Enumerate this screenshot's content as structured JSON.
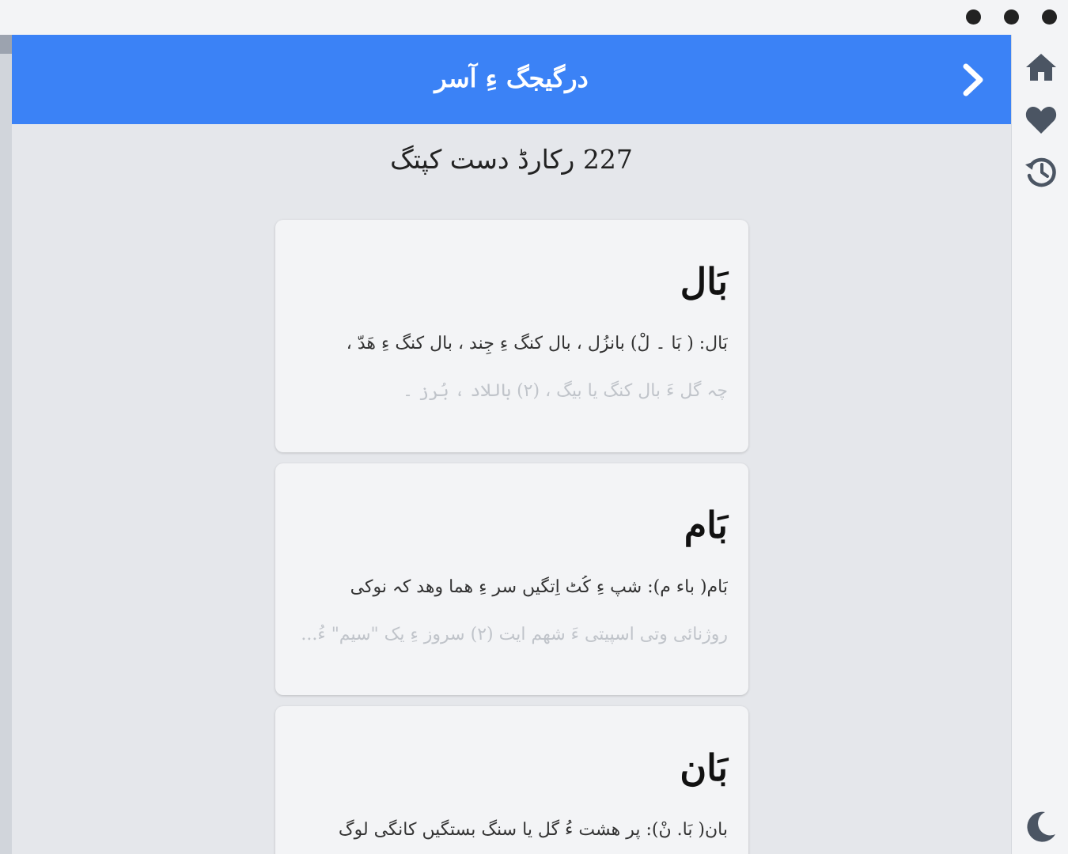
{
  "header": {
    "title": "درگیجگ ءِ آسر"
  },
  "results": {
    "count_text": "227 رکارڈ دست کپتگ"
  },
  "entries": [
    {
      "word": "بَال",
      "line1": "بَال: ( بَا ۔ لْ) بانزُل ، بال کنگ ءِ جِند ، بال کنگ ءِ ھَدّ ،",
      "line2": "چہ گل ءَ بال کنگ یا بیگ ، (۲) باللاد ، بُرز ۔"
    },
    {
      "word": "بَام",
      "line1": "بَام( باء م): شپ ءِ کُٹ اِتگیں سر ءِ ھما وھد کہ نوکی",
      "line2": "روژنائی وتی اسپیتی ءَ شھم ایت (۲) سروز ءِ یک \"سیم\" ءُ..."
    },
    {
      "word": "بَان",
      "line1": "بان( بَا. نْ): پر ھشت ءُ گل یا سنگ بستگیں کانگی لوگ",
      "line2": ""
    }
  ],
  "sidebar": {
    "icons": [
      "home-icon",
      "heart-icon",
      "history-icon",
      "moon-icon"
    ]
  },
  "colors": {
    "header_bg": "#3b82f6",
    "panel_bg": "#e5e7eb",
    "card_bg": "#f3f4f6"
  }
}
